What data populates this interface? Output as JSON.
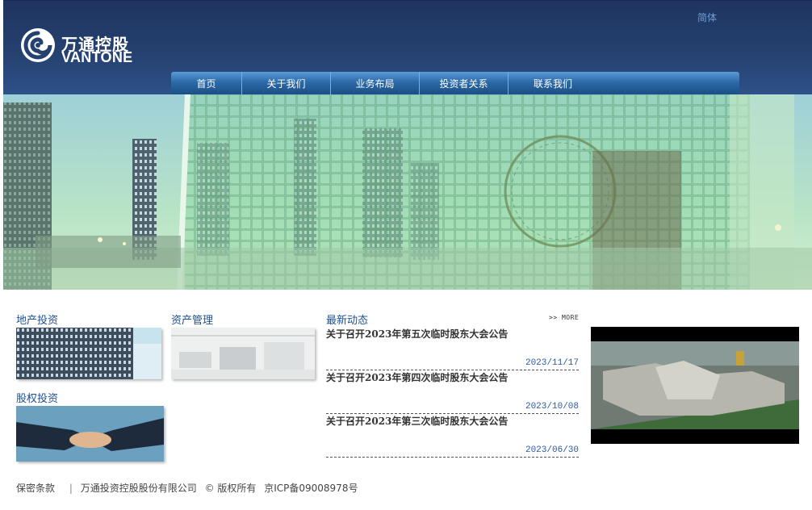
{
  "header": {
    "logo_cn": "万通控股",
    "logo_en": "VANTONE",
    "lang_link": "简体"
  },
  "nav": {
    "items": [
      "首页",
      "关于我们",
      "业务布局",
      "投资者关系",
      "联系我们"
    ]
  },
  "sections": {
    "property": "地产投资",
    "asset": "资产管理",
    "equity": "股权投资"
  },
  "news": {
    "title": "最新动态",
    "more": ">> MORE",
    "items": [
      {
        "text": "关于召开2023年第五次临时股东大会公告",
        "date": "2023/11/17"
      },
      {
        "text": "关于召开2023年第四次临时股东大会公告",
        "date": "2023/10/08"
      },
      {
        "text": "关于召开2023年第三次临时股东大会公告",
        "date": "2023/06/30"
      }
    ]
  },
  "footer": {
    "privacy": "保密条款",
    "separator": "|",
    "company": "万通投资控股股份有限公司",
    "copyright": "© 版权所有",
    "icp": "京ICP备09008978号"
  },
  "colors": {
    "header_bg": "#25416f",
    "nav_bg": "#2c6aa8",
    "section_title": "#1f4f8f",
    "date": "#2a5aa0"
  }
}
